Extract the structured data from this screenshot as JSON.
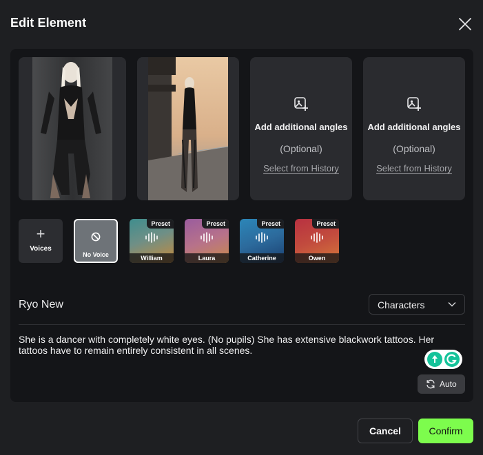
{
  "dialog": {
    "title": "Edit Element",
    "close_icon": "close-icon"
  },
  "reference_images": [
    {
      "alt": "reference-photo-1"
    },
    {
      "alt": "reference-photo-2"
    }
  ],
  "angle_cards": [
    {
      "title": "Add additional angles",
      "optional": "(Optional)",
      "link": "Select from History",
      "icon": "add-image-icon"
    },
    {
      "title": "Add additional angles",
      "optional": "(Optional)",
      "link": "Select from History",
      "icon": "add-image-icon"
    }
  ],
  "voices": {
    "add_label": "Voices",
    "none_label": "No Voice",
    "preset_badge": "Preset",
    "items": [
      {
        "name": "William",
        "colors": [
          "#3f8e8e",
          "#c78a3a"
        ]
      },
      {
        "name": "Laura",
        "colors": [
          "#9a5c9e",
          "#c98b48"
        ]
      },
      {
        "name": "Catherine",
        "colors": [
          "#2c86b8",
          "#1a3f70"
        ]
      },
      {
        "name": "Owen",
        "colors": [
          "#b83140",
          "#d6783a"
        ]
      }
    ]
  },
  "element": {
    "name": "Ryo New",
    "category": "Characters",
    "description": "She is a dancer with completely white eyes. (No pupils) She has extensive blackwork tattoos. Her tattoos have to remain entirely consistent in all scenes."
  },
  "auto_label": "Auto",
  "footer": {
    "cancel": "Cancel",
    "confirm": "Confirm"
  },
  "colors": {
    "accent": "#7dfc4d",
    "background": "#1e1f22",
    "panel": "#141518"
  }
}
